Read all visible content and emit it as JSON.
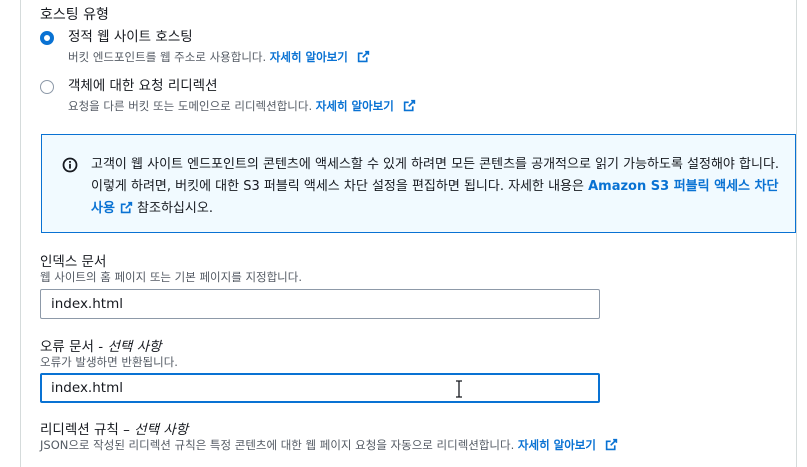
{
  "hosting_type": {
    "title": "호스팅 유형",
    "options": [
      {
        "label": "정적 웹 사이트 호스팅",
        "description": "버킷 엔드포인트를 웹 주소로 사용합니다.",
        "link_text": "자세히 알아보기",
        "selected": true
      },
      {
        "label": "객체에 대한 요청 리디렉션",
        "description": "요청을 다른 버킷 또는 도메인으로 리디렉션합니다.",
        "link_text": "자세히 알아보기",
        "selected": false
      }
    ]
  },
  "info_alert": {
    "text_before": "고객이 웹 사이트 엔드포인트의 콘텐츠에 액세스할 수 있게 하려면 모든 콘텐츠를 공개적으로 읽기 가능하도록 설정해야 합니다. 이렇게 하려면, 버킷에 대한 S3 퍼블릭 액세스 차단 설정을 편집하면 됩니다. 자세한 내용은 ",
    "link_text": "Amazon S3 퍼블릭 액세스 차단 사용",
    "text_after": " 참조하십시오."
  },
  "index_document": {
    "label": "인덱스 문서",
    "description": "웹 사이트의 홈 페이지 또는 기본 페이지를 지정합니다.",
    "value": "index.html"
  },
  "error_document": {
    "label": "오류 문서 - ",
    "label_optional": "선택 사항",
    "description": "오류가 발생하면 반환됩니다.",
    "value": "index.html"
  },
  "redirection_rules": {
    "label": "리디렉션 규칙 – ",
    "label_optional": "선택 사항",
    "description": "JSON으로 작성된 리디렉션 규칙은 특정 콘텐츠에 대한 웹 페이지 요청을 자동으로 리디렉션합니다.",
    "link_text": "자세히 알아보기"
  },
  "colors": {
    "accent": "#0972d3",
    "info_bg": "#f1faff",
    "text": "#16191f",
    "muted": "#545b64"
  }
}
